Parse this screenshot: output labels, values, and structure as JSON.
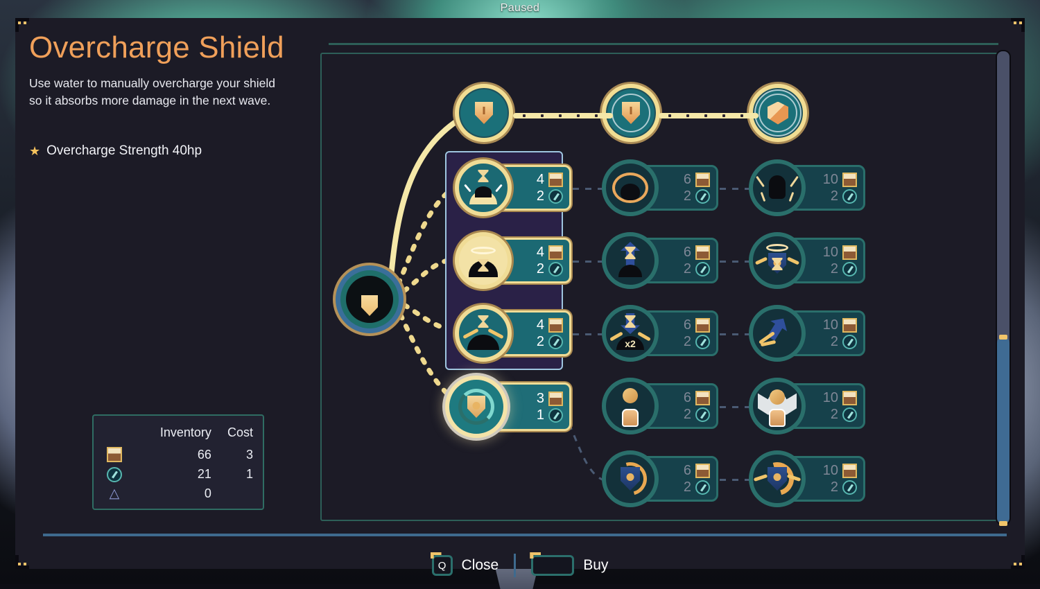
{
  "status": {
    "paused_label": "Paused"
  },
  "header": {
    "title": "Overcharge Shield",
    "description": "Use water to manually overcharge your shield so it absorbs more damage in the next wave.",
    "stats": [
      {
        "icon": "star-icon",
        "label": "Overcharge Strength 40hp"
      }
    ]
  },
  "inventory": {
    "col_icon": "",
    "col_inventory": "Inventory",
    "col_cost": "Cost",
    "rows": [
      {
        "icon": "wood-resource-icon",
        "inventory": "66",
        "cost": "3"
      },
      {
        "icon": "water-resource-icon",
        "inventory": "21",
        "cost": "1"
      },
      {
        "icon": "stone-resource-icon",
        "inventory": "0",
        "cost": ""
      }
    ]
  },
  "tree": {
    "root": {
      "name": "shield-root-node",
      "icon": "shield-icon"
    },
    "tiers": [
      {
        "name": "tier-1-node",
        "icon": "shield-small-icon",
        "state": "unlocked"
      },
      {
        "name": "tier-2-node",
        "icon": "shield-outlined-icon",
        "state": "unlocked"
      },
      {
        "name": "tier-3-node",
        "icon": "shield-cube-icon",
        "state": "unlocked"
      }
    ],
    "columns": [
      {
        "index": 1,
        "cards": [
          {
            "id": "c1r1",
            "icon": "overcharge-burst-icon",
            "wood": "4",
            "water": "2",
            "state": "affordable"
          },
          {
            "id": "c1r2",
            "icon": "overcharge-glow-icon",
            "wood": "4",
            "water": "2",
            "state": "affordable"
          },
          {
            "id": "c1r3",
            "icon": "overcharge-spark-icon",
            "wood": "4",
            "water": "2",
            "state": "affordable"
          },
          {
            "id": "c1r4",
            "icon": "shield-recharge-icon",
            "wood": "3",
            "water": "1",
            "state": "selected"
          }
        ]
      },
      {
        "index": 2,
        "cards": [
          {
            "id": "c2r1",
            "icon": "shield-aura-icon",
            "wood": "6",
            "water": "2",
            "state": "locked"
          },
          {
            "id": "c2r2",
            "icon": "hourglass-up-icon",
            "wood": "6",
            "water": "2",
            "state": "locked"
          },
          {
            "id": "c2r3",
            "icon": "hourglass-x2-icon",
            "wood": "6",
            "water": "2",
            "state": "locked"
          },
          {
            "id": "c2r4",
            "icon": "coin-fist-icon",
            "wood": "6",
            "water": "2",
            "state": "locked"
          },
          {
            "id": "c2r5",
            "icon": "shield-cycle-icon",
            "wood": "6",
            "water": "2",
            "state": "locked"
          }
        ]
      },
      {
        "index": 3,
        "cards": [
          {
            "id": "c3r1",
            "icon": "power-surge-icon",
            "wood": "10",
            "water": "2",
            "state": "locked"
          },
          {
            "id": "c3r2",
            "icon": "blessed-hourglass-icon",
            "wood": "10",
            "water": "2",
            "state": "locked"
          },
          {
            "id": "c3r3",
            "icon": "impact-arrow-icon",
            "wood": "10",
            "water": "2",
            "state": "locked"
          },
          {
            "id": "c3r4",
            "icon": "winged-fist-icon",
            "wood": "10",
            "water": "2",
            "state": "locked"
          },
          {
            "id": "c3r5",
            "icon": "shield-overdrive-icon",
            "wood": "10",
            "water": "2",
            "state": "locked"
          }
        ]
      }
    ]
  },
  "footer": {
    "close_key": "Q",
    "close_label": "Close",
    "buy_key": "",
    "buy_label": "Buy"
  }
}
